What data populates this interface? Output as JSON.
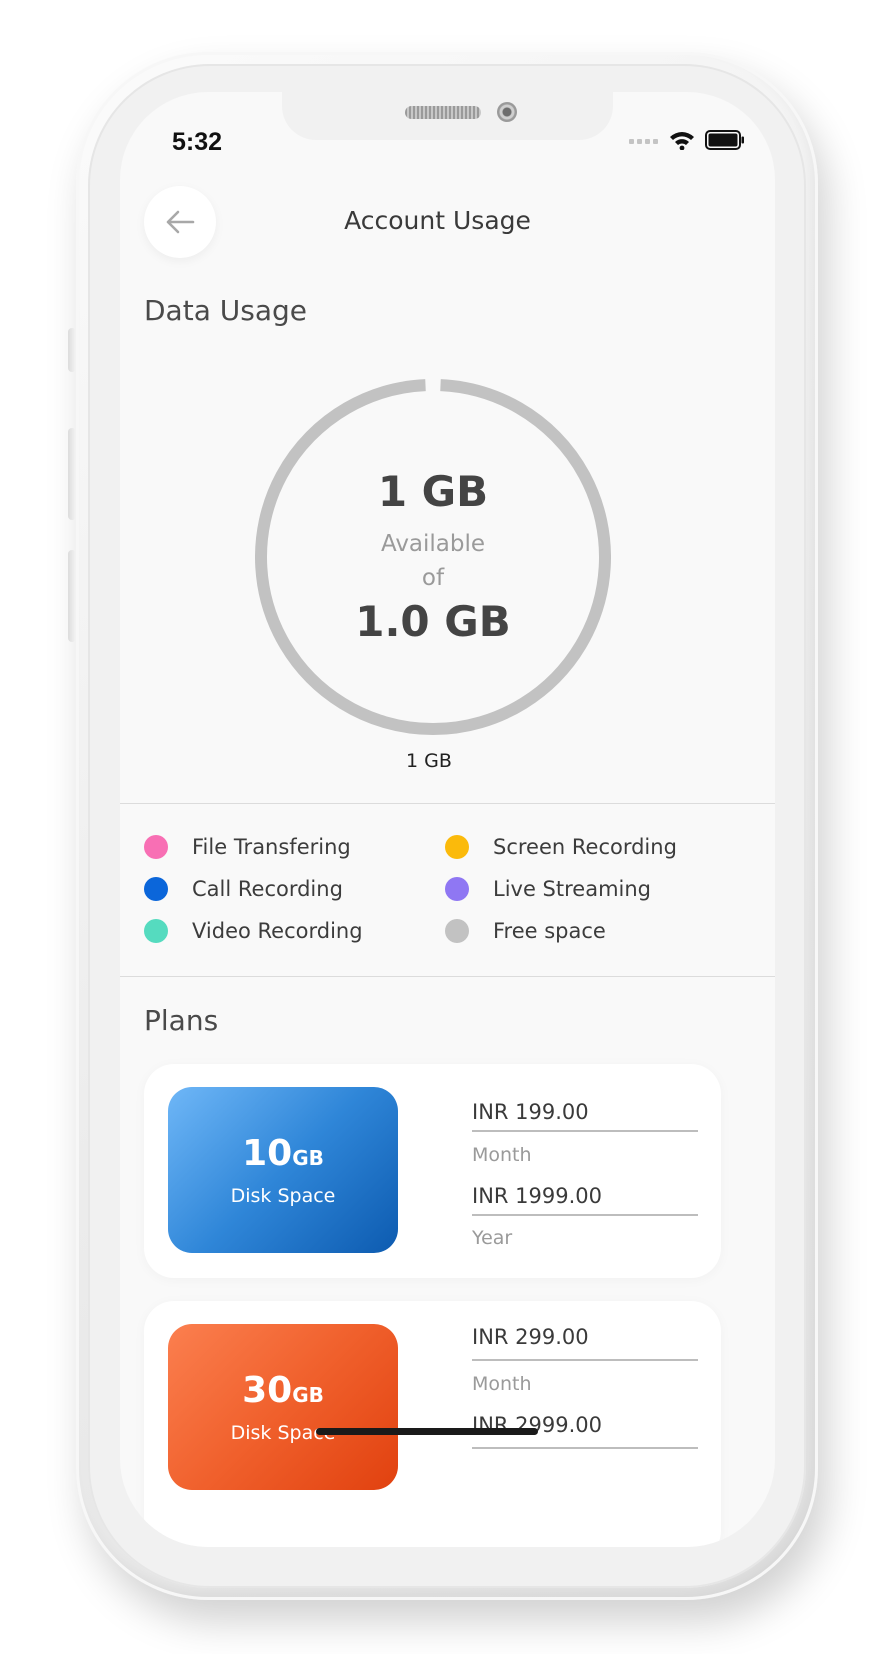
{
  "status_bar": {
    "time": "5:32"
  },
  "header": {
    "title": "Account Usage",
    "back_icon": "arrow-left-icon"
  },
  "data_usage": {
    "section_title": "Data Usage",
    "available": "1 GB",
    "available_label": "Available",
    "of_label": "of",
    "total": "1.0 GB",
    "caption": "1 GB",
    "used_fraction": 0,
    "ring_color": "#c2c2c2"
  },
  "legend": [
    {
      "label": "File Transfering",
      "color": "#f86fb4"
    },
    {
      "label": "Screen Recording",
      "color": "#fbba0b"
    },
    {
      "label": "Call Recording",
      "color": "#0b66da"
    },
    {
      "label": "Live Streaming",
      "color": "#8f77f3"
    },
    {
      "label": "Video Recording",
      "color": "#55dbbf"
    },
    {
      "label": "Free space",
      "color": "#c2c2c2"
    }
  ],
  "plans": {
    "section_title": "Plans",
    "items": [
      {
        "size": "10",
        "unit": "GB",
        "description": "Disk Space",
        "monthly_price": "INR 199.00",
        "monthly_label": "Month",
        "yearly_price": "INR 1999.00",
        "yearly_label": "Year",
        "color": "#2f86d8"
      },
      {
        "size": "30",
        "unit": "GB",
        "description": "Disk Space",
        "monthly_price": "INR 299.00",
        "monthly_label": "Month",
        "yearly_price": "INR 2999.00",
        "color": "#f0602c"
      }
    ]
  }
}
